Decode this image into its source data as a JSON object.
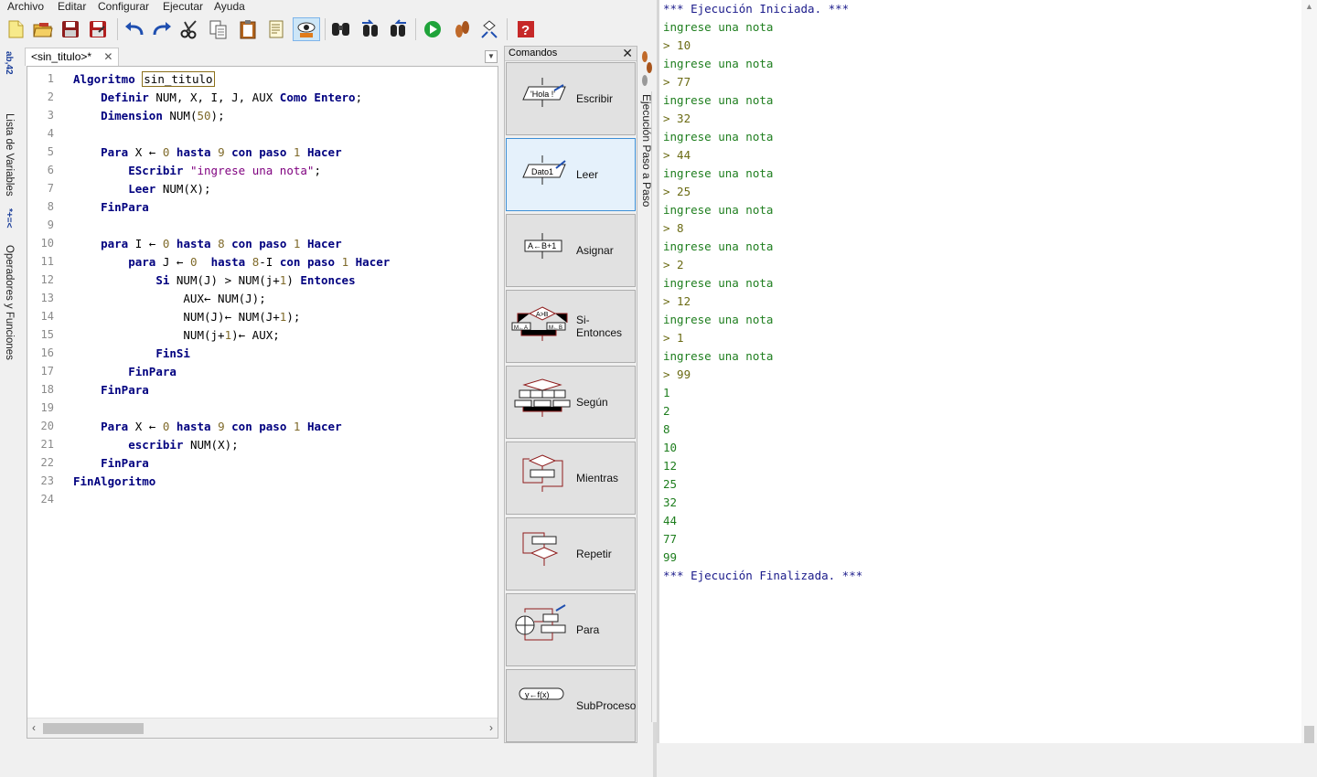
{
  "menu": [
    "Archivo",
    "Editar",
    "Configurar",
    "Ejecutar",
    "Ayuda"
  ],
  "toolbar": {
    "icons": [
      "new-file-icon",
      "open-folder-icon",
      "save-icon",
      "save-as-icon",
      "undo-icon",
      "redo-icon",
      "cut-icon",
      "copy-icon",
      "paste-icon",
      "edit-note-icon",
      "inspect-eye-icon",
      "find-icon",
      "find-prev-icon",
      "find-next-icon",
      "run-icon",
      "step-by-step-icon",
      "flowchart-icon",
      "help-icon"
    ],
    "active": "inspect-eye-icon"
  },
  "left_tabs": {
    "variables": {
      "icon_text": "*+=<",
      "label": "Lista de Variables",
      "glyph": "ab,42"
    },
    "operators": {
      "icon_text": "*+=<",
      "label": "Operadores y Funciones"
    }
  },
  "editor": {
    "tab_label": "<sin_titulo>*",
    "tab_close": "✕",
    "line_numbers": [
      "1",
      "2",
      "3",
      "4",
      "5",
      "6",
      "7",
      "8",
      "9",
      "10",
      "11",
      "12",
      "13",
      "14",
      "15",
      "16",
      "17",
      "18",
      "19",
      "20",
      "21",
      "22",
      "23",
      "24"
    ],
    "lines": [
      [
        {
          "t": "kw",
          "v": "Algoritmo"
        },
        {
          "t": "tok",
          "v": " "
        },
        {
          "t": "title",
          "v": "sin_titulo"
        }
      ],
      [
        {
          "t": "tok",
          "v": "    "
        },
        {
          "t": "kw",
          "v": "Definir"
        },
        {
          "t": "tok",
          "v": " NUM, X, I, J, AUX "
        },
        {
          "t": "kw",
          "v": "Como Entero"
        },
        {
          "t": "tok",
          "v": ";"
        }
      ],
      [
        {
          "t": "tok",
          "v": "    "
        },
        {
          "t": "kw",
          "v": "Dimension"
        },
        {
          "t": "tok",
          "v": " NUM("
        },
        {
          "t": "num",
          "v": "50"
        },
        {
          "t": "tok",
          "v": ");"
        }
      ],
      [],
      [
        {
          "t": "tok",
          "v": "    "
        },
        {
          "t": "kw",
          "v": "Para"
        },
        {
          "t": "tok",
          "v": " X "
        },
        {
          "t": "tok",
          "v": "← "
        },
        {
          "t": "num",
          "v": "0"
        },
        {
          "t": "tok",
          "v": " "
        },
        {
          "t": "kw",
          "v": "hasta"
        },
        {
          "t": "tok",
          "v": " "
        },
        {
          "t": "num",
          "v": "9"
        },
        {
          "t": "tok",
          "v": " "
        },
        {
          "t": "kw",
          "v": "con paso"
        },
        {
          "t": "tok",
          "v": " "
        },
        {
          "t": "num",
          "v": "1"
        },
        {
          "t": "tok",
          "v": " "
        },
        {
          "t": "kw",
          "v": "Hacer"
        }
      ],
      [
        {
          "t": "tok",
          "v": "        "
        },
        {
          "t": "kw",
          "v": "EScribir"
        },
        {
          "t": "tok",
          "v": " "
        },
        {
          "t": "str",
          "v": "\"ingrese una nota\""
        },
        {
          "t": "tok",
          "v": ";"
        }
      ],
      [
        {
          "t": "tok",
          "v": "        "
        },
        {
          "t": "kw",
          "v": "Leer"
        },
        {
          "t": "tok",
          "v": " NUM(X);"
        }
      ],
      [
        {
          "t": "tok",
          "v": "    "
        },
        {
          "t": "kw",
          "v": "FinPara"
        }
      ],
      [],
      [
        {
          "t": "tok",
          "v": "    "
        },
        {
          "t": "kw",
          "v": "para"
        },
        {
          "t": "tok",
          "v": " I "
        },
        {
          "t": "tok",
          "v": "← "
        },
        {
          "t": "num",
          "v": "0"
        },
        {
          "t": "tok",
          "v": " "
        },
        {
          "t": "kw",
          "v": "hasta"
        },
        {
          "t": "tok",
          "v": " "
        },
        {
          "t": "num",
          "v": "8"
        },
        {
          "t": "tok",
          "v": " "
        },
        {
          "t": "kw",
          "v": "con paso"
        },
        {
          "t": "tok",
          "v": " "
        },
        {
          "t": "num",
          "v": "1"
        },
        {
          "t": "tok",
          "v": " "
        },
        {
          "t": "kw",
          "v": "Hacer"
        }
      ],
      [
        {
          "t": "tok",
          "v": "        "
        },
        {
          "t": "kw",
          "v": "para"
        },
        {
          "t": "tok",
          "v": " J "
        },
        {
          "t": "tok",
          "v": "← "
        },
        {
          "t": "num",
          "v": "0"
        },
        {
          "t": "tok",
          "v": "  "
        },
        {
          "t": "kw",
          "v": "hasta"
        },
        {
          "t": "tok",
          "v": " "
        },
        {
          "t": "num",
          "v": "8"
        },
        {
          "t": "tok",
          "v": "-I "
        },
        {
          "t": "kw",
          "v": "con paso"
        },
        {
          "t": "tok",
          "v": " "
        },
        {
          "t": "num",
          "v": "1"
        },
        {
          "t": "tok",
          "v": " "
        },
        {
          "t": "kw",
          "v": "Hacer"
        }
      ],
      [
        {
          "t": "tok",
          "v": "            "
        },
        {
          "t": "kw",
          "v": "Si"
        },
        {
          "t": "tok",
          "v": " NUM(J) > NUM(j+"
        },
        {
          "t": "num",
          "v": "1"
        },
        {
          "t": "tok",
          "v": ") "
        },
        {
          "t": "kw",
          "v": "Entonces"
        }
      ],
      [
        {
          "t": "tok",
          "v": "                AUX← NUM(J);"
        }
      ],
      [
        {
          "t": "tok",
          "v": "                NUM(J)← NUM(J+"
        },
        {
          "t": "num",
          "v": "1"
        },
        {
          "t": "tok",
          "v": ");"
        }
      ],
      [
        {
          "t": "tok",
          "v": "                NUM(j+"
        },
        {
          "t": "num",
          "v": "1"
        },
        {
          "t": "tok",
          "v": ")← AUX;"
        }
      ],
      [
        {
          "t": "tok",
          "v": "            "
        },
        {
          "t": "kw",
          "v": "FinSi"
        }
      ],
      [
        {
          "t": "tok",
          "v": "        "
        },
        {
          "t": "kw",
          "v": "FinPara"
        }
      ],
      [
        {
          "t": "tok",
          "v": "    "
        },
        {
          "t": "kw",
          "v": "FinPara"
        }
      ],
      [],
      [
        {
          "t": "tok",
          "v": "    "
        },
        {
          "t": "kw",
          "v": "Para"
        },
        {
          "t": "tok",
          "v": " X "
        },
        {
          "t": "tok",
          "v": "← "
        },
        {
          "t": "num",
          "v": "0"
        },
        {
          "t": "tok",
          "v": " "
        },
        {
          "t": "kw",
          "v": "hasta"
        },
        {
          "t": "tok",
          "v": " "
        },
        {
          "t": "num",
          "v": "9"
        },
        {
          "t": "tok",
          "v": " "
        },
        {
          "t": "kw",
          "v": "con paso"
        },
        {
          "t": "tok",
          "v": " "
        },
        {
          "t": "num",
          "v": "1"
        },
        {
          "t": "tok",
          "v": " "
        },
        {
          "t": "kw",
          "v": "Hacer"
        }
      ],
      [
        {
          "t": "tok",
          "v": "        "
        },
        {
          "t": "kw",
          "v": "escribir"
        },
        {
          "t": "tok",
          "v": " NUM(X);"
        }
      ],
      [
        {
          "t": "tok",
          "v": "    "
        },
        {
          "t": "kw",
          "v": "FinPara"
        }
      ],
      [
        {
          "t": "kw",
          "v": "FinAlgoritmo"
        }
      ],
      []
    ]
  },
  "commands": {
    "title": "Comandos",
    "close": "✕",
    "items": [
      {
        "label": "Escribir",
        "icon": "escribir-icon",
        "glyph": "'Hola !'"
      },
      {
        "label": "Leer",
        "icon": "leer-icon",
        "glyph": "Dato1",
        "selected": true
      },
      {
        "label": "Asignar",
        "icon": "asignar-icon",
        "glyph": "A←B+1"
      },
      {
        "label": "Si-Entonces",
        "icon": "si-entonces-icon",
        "glyph": "A>B"
      },
      {
        "label": "Según",
        "icon": "segun-icon",
        "glyph": ""
      },
      {
        "label": "Mientras",
        "icon": "mientras-icon",
        "glyph": ""
      },
      {
        "label": "Repetir",
        "icon": "repetir-icon",
        "glyph": ""
      },
      {
        "label": "Para",
        "icon": "para-icon",
        "glyph": ""
      },
      {
        "label": "SubProceso",
        "icon": "subproceso-icon",
        "glyph": "y←f(x)"
      }
    ]
  },
  "step_panel": {
    "label": "Ejecución Paso a Paso"
  },
  "console": {
    "lines": [
      {
        "k": "sys",
        "v": "*** Ejecución Iniciada. ***"
      },
      {
        "k": "out",
        "v": "ingrese una nota"
      },
      {
        "k": "in",
        "v": "> 10"
      },
      {
        "k": "out",
        "v": "ingrese una nota"
      },
      {
        "k": "in",
        "v": "> 77"
      },
      {
        "k": "out",
        "v": "ingrese una nota"
      },
      {
        "k": "in",
        "v": "> 32"
      },
      {
        "k": "out",
        "v": "ingrese una nota"
      },
      {
        "k": "in",
        "v": "> 44"
      },
      {
        "k": "out",
        "v": "ingrese una nota"
      },
      {
        "k": "in",
        "v": "> 25"
      },
      {
        "k": "out",
        "v": "ingrese una nota"
      },
      {
        "k": "in",
        "v": "> 8"
      },
      {
        "k": "out",
        "v": "ingrese una nota"
      },
      {
        "k": "in",
        "v": "> 2"
      },
      {
        "k": "out",
        "v": "ingrese una nota"
      },
      {
        "k": "in",
        "v": "> 12"
      },
      {
        "k": "out",
        "v": "ingrese una nota"
      },
      {
        "k": "in",
        "v": "> 1"
      },
      {
        "k": "out",
        "v": "ingrese una nota"
      },
      {
        "k": "in",
        "v": "> 99"
      },
      {
        "k": "out",
        "v": "1"
      },
      {
        "k": "out",
        "v": "2"
      },
      {
        "k": "out",
        "v": "8"
      },
      {
        "k": "out",
        "v": "10"
      },
      {
        "k": "out",
        "v": "12"
      },
      {
        "k": "out",
        "v": "25"
      },
      {
        "k": "out",
        "v": "32"
      },
      {
        "k": "out",
        "v": "44"
      },
      {
        "k": "out",
        "v": "77"
      },
      {
        "k": "out",
        "v": "99"
      },
      {
        "k": "sys",
        "v": "*** Ejecución Finalizada. ***"
      }
    ]
  },
  "colors": {
    "keyword": "#00007f",
    "number": "#7f6a2a",
    "string": "#7f007f",
    "console_system": "#1a1a8a",
    "console_output": "#1e7e1e",
    "console_input": "#6b6b14",
    "selected_command": "#e5f1fb"
  }
}
